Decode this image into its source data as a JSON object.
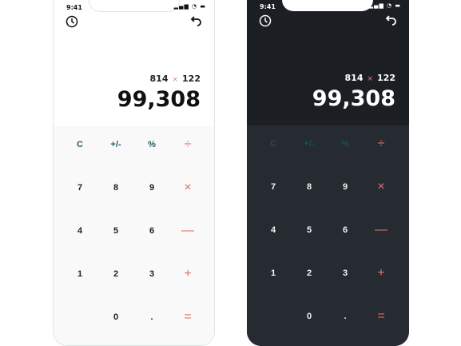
{
  "status_time": "9:41",
  "status_icons": "▂▄▆ ◔ ▬",
  "expression": {
    "left": "814",
    "operator": "×",
    "right": "122"
  },
  "result": "99,308",
  "keys": [
    [
      {
        "l": "C",
        "t": "fn",
        "n": "clear"
      },
      {
        "l": "+/-",
        "t": "fn",
        "n": "sign"
      },
      {
        "l": "%",
        "t": "fn",
        "n": "percent"
      },
      {
        "l": "÷",
        "t": "op",
        "n": "divide"
      }
    ],
    [
      {
        "l": "7",
        "t": "num",
        "n": "7"
      },
      {
        "l": "8",
        "t": "num",
        "n": "8"
      },
      {
        "l": "9",
        "t": "num",
        "n": "9"
      },
      {
        "l": "×",
        "t": "op",
        "n": "multiply"
      }
    ],
    [
      {
        "l": "4",
        "t": "num",
        "n": "4"
      },
      {
        "l": "5",
        "t": "num",
        "n": "5"
      },
      {
        "l": "6",
        "t": "num",
        "n": "6"
      },
      {
        "l": "—",
        "t": "op",
        "n": "subtract"
      }
    ],
    [
      {
        "l": "1",
        "t": "num",
        "n": "1"
      },
      {
        "l": "2",
        "t": "num",
        "n": "2"
      },
      {
        "l": "3",
        "t": "num",
        "n": "3"
      },
      {
        "l": "+",
        "t": "op",
        "n": "add"
      }
    ],
    [
      null,
      {
        "l": "0",
        "t": "num",
        "n": "0"
      },
      {
        "l": ".",
        "t": "num",
        "n": "decimal"
      },
      {
        "l": "=",
        "t": "op",
        "n": "equals"
      }
    ]
  ],
  "themes": [
    "light",
    "dark"
  ],
  "colors": {
    "accent_operator": "#e46d6d",
    "accent_function": "#1f5f68",
    "dark_bg": "#1b1e22",
    "dark_pad": "#262a31",
    "light_pad": "#f9f9f9"
  },
  "icons": {
    "history": "clock-icon",
    "undo": "undo-icon"
  }
}
